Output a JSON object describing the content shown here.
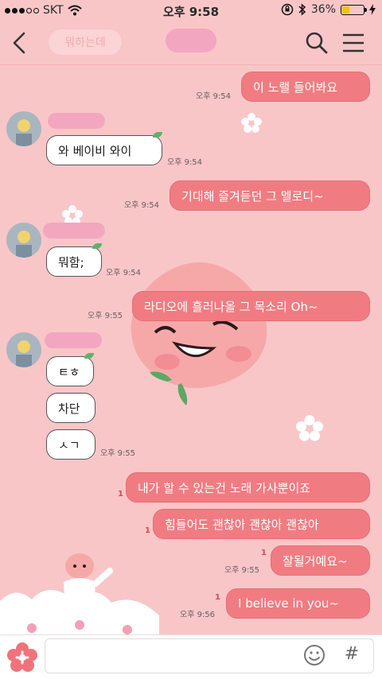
{
  "status": {
    "carrier": "SKT",
    "time": "오후 9:58",
    "battery": "36%",
    "battery_level": 0.36
  },
  "header": {
    "title_placeholder": "뭐하는데"
  },
  "messages": [
    {
      "side": "me",
      "text": "이 노랠 들어봐요",
      "time": "오후 9:54"
    },
    {
      "side": "them",
      "text": "와 베이비 와이",
      "time": "오후 9:54"
    },
    {
      "side": "me",
      "text": "기대해 즐겨듣던 그 멜로디~",
      "time": "오후 9:54"
    },
    {
      "side": "them",
      "text": "뭐함;",
      "time": "오후 9:54"
    },
    {
      "side": "me",
      "text": "라디오에 흘러나올 그 목소리 Oh~",
      "time": "오후 9:55"
    },
    {
      "side": "them",
      "text": "ㅌㅎ",
      "time": ""
    },
    {
      "side": "them",
      "text": "차단",
      "time": ""
    },
    {
      "side": "them",
      "text": "ㅅㄱ",
      "time": "오후 9:55"
    },
    {
      "side": "me",
      "text": "내가 할 수 있는건 노래 가사뿐이죠",
      "read": "1"
    },
    {
      "side": "me",
      "text": "힘들어도 괜찮아 괜찮아 괜찮아",
      "read": "1"
    },
    {
      "side": "me",
      "text": "잘될거예요~",
      "read": "1",
      "time": "오후 9:55"
    },
    {
      "side": "me",
      "text": "I believe in you~",
      "read": "1",
      "time": "오후 9:56"
    }
  ],
  "colors": {
    "bg": "#f9c6c8",
    "my_bubble": "#f07c82",
    "their_bubble": "#ffffff",
    "accent_pink": "#f3a6c0"
  },
  "icons": [
    "back-arrow-icon",
    "search-icon",
    "menu-icon",
    "plus-flower-icon",
    "emoji-icon",
    "hash-icon"
  ],
  "input": {
    "hash": "#"
  }
}
